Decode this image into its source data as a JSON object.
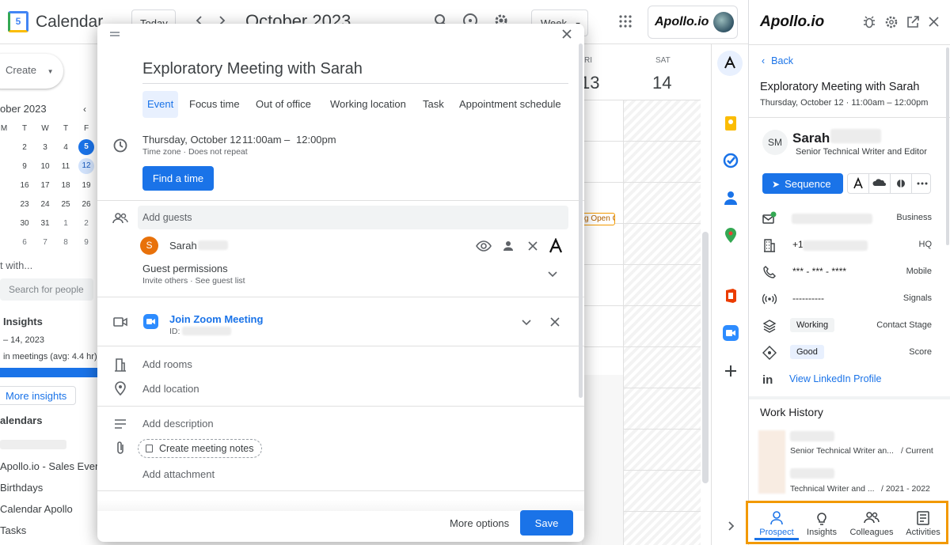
{
  "topbar": {
    "app_logo_text": "5",
    "app_name": "Calendar",
    "today_label": "Today",
    "month_title": "October 2023",
    "view_select": "Week",
    "apollo_badge": "Apollo.io"
  },
  "sidebar": {
    "create_label": "Create",
    "mini_cal_title": "ober 2023",
    "weekdays": [
      "M",
      "T",
      "W",
      "T",
      "F",
      "S"
    ],
    "weeks": [
      [
        "2",
        "3",
        "4",
        "5",
        "6"
      ],
      [
        "9",
        "10",
        "11",
        "12",
        "13"
      ],
      [
        "16",
        "17",
        "18",
        "19",
        "20"
      ],
      [
        "23",
        "24",
        "25",
        "26",
        "27"
      ],
      [
        "30",
        "31",
        "1",
        "2",
        "3"
      ],
      [
        "6",
        "7",
        "8",
        "9",
        "10"
      ]
    ],
    "meet_with": "t with...",
    "search_people_placeholder": "Search for people",
    "insights_title": "Insights",
    "insights_range": "– 14, 2023",
    "insights_meetings": "in meetings (avg: 4.4 hr)",
    "more_insights": "More insights",
    "calendars_title": "alendars",
    "calendars": [
      "Apollo.io - Sales Events",
      "Birthdays",
      "Calendar Apollo",
      "Tasks"
    ]
  },
  "grid": {
    "fri_label": "RI",
    "fri_num": "13",
    "sat_label": "SAT",
    "sat_num": "14",
    "event_chip": "g Open C"
  },
  "modal": {
    "title": "Exploratory Meeting with Sarah",
    "tabs": [
      "Event",
      "Focus time",
      "Out of office",
      "Working location",
      "Task",
      "Appointment schedule"
    ],
    "date": "Thursday, October 12",
    "time_start": "11:00am",
    "time_dash": "–",
    "time_end": "12:00pm",
    "time_sub": "Time zone · Does not repeat",
    "find_time": "Find a time",
    "add_guests": "Add guests",
    "guest_initial": "S",
    "guest_name": "Sarah",
    "guest_permissions": "Guest permissions",
    "guest_permissions_sub": "Invite others · See guest list",
    "zoom_join": "Join Zoom Meeting",
    "zoom_id": "ID:",
    "add_rooms": "Add rooms",
    "add_location": "Add location",
    "add_description": "Add description",
    "create_notes": "Create meeting notes",
    "add_attachment": "Add attachment",
    "more_options": "More options",
    "save": "Save"
  },
  "apollo": {
    "logo": "Apollo.io",
    "back": "Back",
    "meeting_title": "Exploratory Meeting with Sarah",
    "meeting_time": "Thursday, October 12 · 11:00am – 12:00pm",
    "contact_initials": "SM",
    "contact_name": "Sarah",
    "contact_title": "Senior Technical Writer and Editor",
    "sequence": "Sequence",
    "rows": {
      "business_label": "Business",
      "hq_value": "+1",
      "hq_label": "HQ",
      "mobile_value": "*** - *** - ****",
      "mobile_label": "Mobile",
      "signals_value": "----------",
      "signals_label": "Signals",
      "stage_value": "Working",
      "stage_label": "Contact Stage",
      "score_value": "Good",
      "score_label": "Score",
      "linkedin": "View LinkedIn Profile"
    },
    "work_history_title": "Work History",
    "jobs": [
      {
        "title": "Senior Technical Writer an...",
        "period": "/ Current"
      },
      {
        "title": "Technical Writer and ...",
        "period": "/ 2021 - 2022"
      }
    ],
    "nav": [
      "Prospect",
      "Insights",
      "Colleagues",
      "Activities"
    ],
    "accent": "#1a73e8",
    "highlight": "#f29900"
  }
}
